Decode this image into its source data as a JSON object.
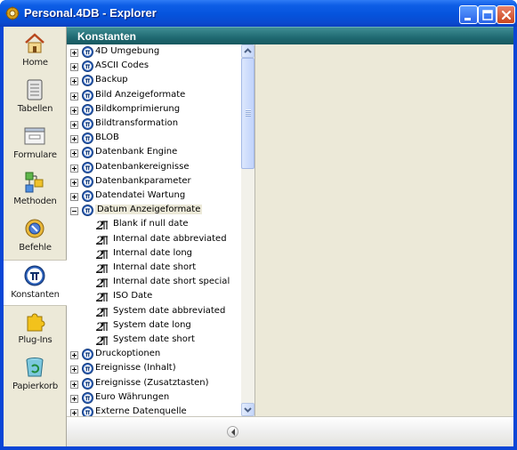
{
  "window": {
    "title": "Personal.4DB - Explorer",
    "icons": {
      "app": "gear-icon",
      "minimize": "minimize-icon",
      "maximize": "maximize-icon",
      "close": "close-icon"
    }
  },
  "nav": {
    "items": [
      {
        "label": "Home",
        "icon": "home-icon",
        "active": false
      },
      {
        "label": "Tabellen",
        "icon": "table-icon",
        "active": false
      },
      {
        "label": "Formulare",
        "icon": "form-icon",
        "active": false
      },
      {
        "label": "Methoden",
        "icon": "method-icon",
        "active": false
      },
      {
        "label": "Befehle",
        "icon": "command-icon",
        "active": false
      },
      {
        "label": "Konstanten",
        "icon": "pi-icon",
        "active": true
      },
      {
        "label": "Plug-Ins",
        "icon": "puzzle-icon",
        "active": false
      },
      {
        "label": "Papierkorb",
        "icon": "trash-icon",
        "active": false
      }
    ]
  },
  "panel": {
    "title": "Konstanten"
  },
  "tree": {
    "items": [
      {
        "label": "4D Umgebung",
        "level": 0,
        "expanded": false
      },
      {
        "label": "ASCII Codes",
        "level": 0,
        "expanded": false
      },
      {
        "label": "Backup",
        "level": 0,
        "expanded": false
      },
      {
        "label": "Bild Anzeigeformate",
        "level": 0,
        "expanded": false
      },
      {
        "label": "Bildkomprimierung",
        "level": 0,
        "expanded": false
      },
      {
        "label": "Bildtransformation",
        "level": 0,
        "expanded": false
      },
      {
        "label": "BLOB",
        "level": 0,
        "expanded": false
      },
      {
        "label": "Datenbank Engine",
        "level": 0,
        "expanded": false
      },
      {
        "label": "Datenbankereignisse",
        "level": 0,
        "expanded": false
      },
      {
        "label": "Datenbankparameter",
        "level": 0,
        "expanded": false
      },
      {
        "label": "Datendatei Wartung",
        "level": 0,
        "expanded": false
      },
      {
        "label": "Datum Anzeigeformate",
        "level": 0,
        "expanded": true,
        "selected": true
      },
      {
        "label": "Blank if null date",
        "level": 1
      },
      {
        "label": "Internal date abbreviated",
        "level": 1
      },
      {
        "label": "Internal date long",
        "level": 1
      },
      {
        "label": "Internal date short",
        "level": 1
      },
      {
        "label": "Internal date short special",
        "level": 1
      },
      {
        "label": "ISO Date",
        "level": 1
      },
      {
        "label": "System date abbreviated",
        "level": 1
      },
      {
        "label": "System date long",
        "level": 1
      },
      {
        "label": "System date short",
        "level": 1
      },
      {
        "label": "Druckoptionen",
        "level": 0,
        "expanded": false
      },
      {
        "label": "Ereignisse (Inhalt)",
        "level": 0,
        "expanded": false
      },
      {
        "label": "Ereignisse (Zusatztasten)",
        "level": 0,
        "expanded": false
      },
      {
        "label": "Euro Währungen",
        "level": 0,
        "expanded": false
      },
      {
        "label": "Externe Datenquelle",
        "level": 0,
        "expanded": false
      }
    ]
  },
  "colors": {
    "title_bar": "#0553dc",
    "panel_header": "#1f6971",
    "selection": "#ece9d8"
  }
}
